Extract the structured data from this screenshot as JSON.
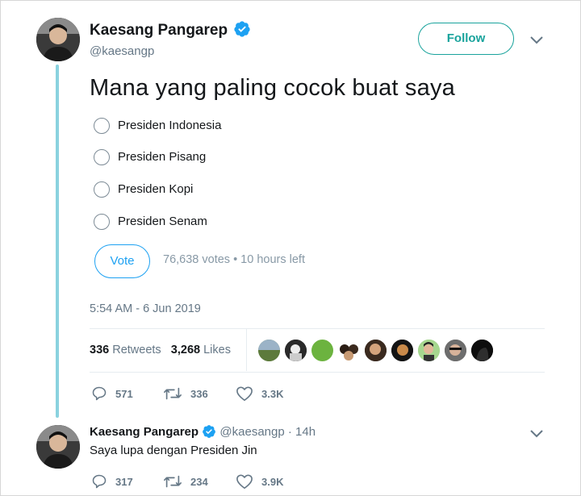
{
  "main_tweet": {
    "author_name": "Kaesang Pangarep",
    "handle": "@kaesangp",
    "follow_label": "Follow",
    "text": "Mana yang paling cocok buat saya",
    "poll": {
      "options": [
        "Presiden Indonesia",
        "Presiden Pisang",
        "Presiden Kopi",
        "Presiden Senam"
      ],
      "vote_label": "Vote",
      "meta": "76,638 votes • 10 hours left"
    },
    "timestamp": "5:54 AM - 6 Jun 2019",
    "stats": {
      "retweets_count": "336",
      "retweets_label": "Retweets",
      "likes_count": "3,268",
      "likes_label": "Likes"
    },
    "actions": {
      "replies": "571",
      "retweets": "336",
      "likes": "3.3K"
    }
  },
  "reply_tweet": {
    "author_name": "Kaesang Pangarep",
    "handle_time": "@kaesangp · 14h",
    "text": "Saya lupa dengan Presiden Jin",
    "actions": {
      "replies": "317",
      "retweets": "234",
      "likes": "3.9K"
    }
  },
  "colors": {
    "accent": "#1da1f2",
    "follow_teal": "#19a39c",
    "thread_line": "#8ad2df",
    "verified": "#1da1f2"
  }
}
